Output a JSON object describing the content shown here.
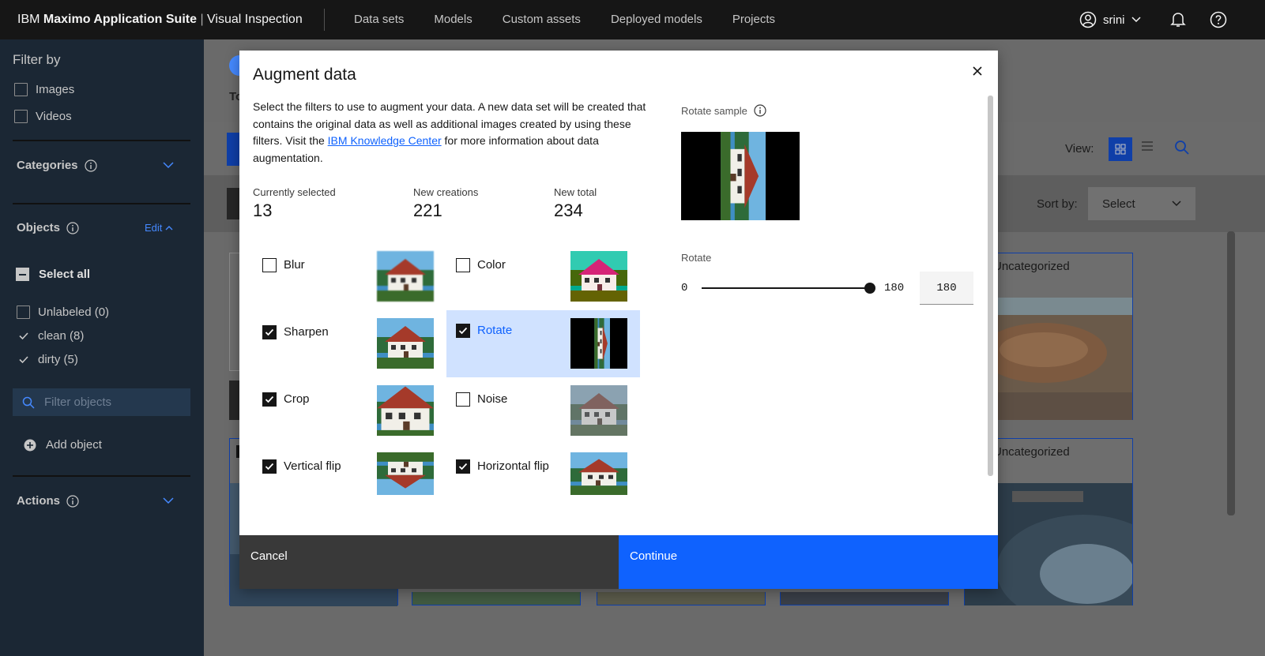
{
  "header": {
    "brand_prefix": "IBM",
    "brand_name": "Maximo Application Suite",
    "brand_sep": " | ",
    "brand_product": "Visual Inspection",
    "nav": [
      "Data sets",
      "Models",
      "Custom assets",
      "Deployed models",
      "Projects"
    ],
    "user_name": "srini",
    "icons": [
      "user-avatar-icon",
      "chevron-down-icon",
      "bell-icon",
      "help-icon"
    ]
  },
  "sidebar": {
    "filter_title": "Filter by",
    "filters": [
      {
        "label": "Images",
        "checked": false
      },
      {
        "label": "Videos",
        "checked": false
      }
    ],
    "categories_label": "Categories",
    "objects_label": "Objects",
    "edit_label": "Edit",
    "select_all_label": "Select all",
    "objects": [
      {
        "label": "Unlabeled (0)",
        "checked": false
      },
      {
        "label": "clean (8)",
        "checked": true
      },
      {
        "label": "dirty (5)",
        "checked": true
      }
    ],
    "filter_placeholder": "Filter objects",
    "add_object_label": "Add object",
    "actions_label": "Actions"
  },
  "main": {
    "title_fragment": "To",
    "view_label": "View:",
    "sort_label": "Sort by:",
    "sort_value": "Select",
    "card_label": "Uncategorized"
  },
  "modal": {
    "title": "Augment data",
    "desc_before": "Select the filters to use to augment your data. A new data set will be created that contains the original data as well as additional images created by using these filters. Visit the ",
    "desc_link": "IBM Knowledge Center",
    "desc_after": " for more information about data augmentation.",
    "stats": [
      {
        "label": "Currently selected",
        "value": "13"
      },
      {
        "label": "New creations",
        "value": "221"
      },
      {
        "label": "New total",
        "value": "234"
      }
    ],
    "filters": [
      {
        "label": "Blur",
        "checked": false,
        "selected": false
      },
      {
        "label": "Color",
        "checked": false,
        "selected": false
      },
      {
        "label": "Sharpen",
        "checked": true,
        "selected": false
      },
      {
        "label": "Rotate",
        "checked": true,
        "selected": true
      },
      {
        "label": "Crop",
        "checked": true,
        "selected": false
      },
      {
        "label": "Noise",
        "checked": false,
        "selected": false
      },
      {
        "label": "Vertical flip",
        "checked": true,
        "selected": false
      },
      {
        "label": "Horizontal flip",
        "checked": true,
        "selected": false
      }
    ],
    "sample_label": "Rotate sample",
    "rotate_label": "Rotate",
    "slider_min": "0",
    "slider_max": "180",
    "slider_value": "180",
    "cancel_label": "Cancel",
    "continue_label": "Continue"
  },
  "colors": {
    "accent": "#0f62fe",
    "header_bg": "#161616",
    "sidebar_bg": "#1b2734",
    "selected_cell": "#d0e2ff"
  }
}
